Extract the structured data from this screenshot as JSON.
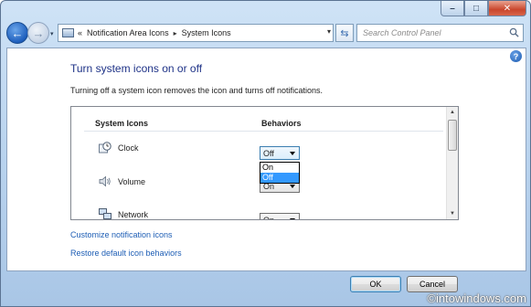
{
  "window": {
    "minimize_glyph": "–",
    "maximize_glyph": "□",
    "close_glyph": "✕"
  },
  "navigation": {
    "back_glyph": "←",
    "forward_glyph": "→",
    "history_glyph": "▾",
    "breadcrumb": [
      "Notification Area Icons",
      "System Icons"
    ],
    "breadcrumb_prefix": "«",
    "breadcrumb_separator": "▸",
    "address_dropdown_glyph": "▾",
    "refresh_glyph": "⇆",
    "search_placeholder": "Search Control Panel"
  },
  "help_glyph": "?",
  "page": {
    "title": "Turn system icons on or off",
    "description": "Turning off a system icon removes the icon and turns off notifications."
  },
  "table": {
    "headers": [
      "System Icons",
      "Behaviors"
    ],
    "rows": [
      {
        "icon": "clock-icon",
        "label": "Clock",
        "behavior": "Off"
      },
      {
        "icon": "volume-icon",
        "label": "Volume",
        "behavior": "On"
      },
      {
        "icon": "network-icon",
        "label": "Network",
        "behavior": "On"
      }
    ],
    "dropdown_options": [
      "On",
      "Off"
    ],
    "dropdown_selected": "Off"
  },
  "links": {
    "customize": "Customize notification icons",
    "restore": "Restore default icon behaviors"
  },
  "buttons": {
    "ok": "OK",
    "cancel": "Cancel"
  },
  "watermark": "©intowindows.com",
  "colors": {
    "title_blue": "#1e3287",
    "link_blue": "#1e5eb5",
    "selection_blue": "#3399ff"
  }
}
